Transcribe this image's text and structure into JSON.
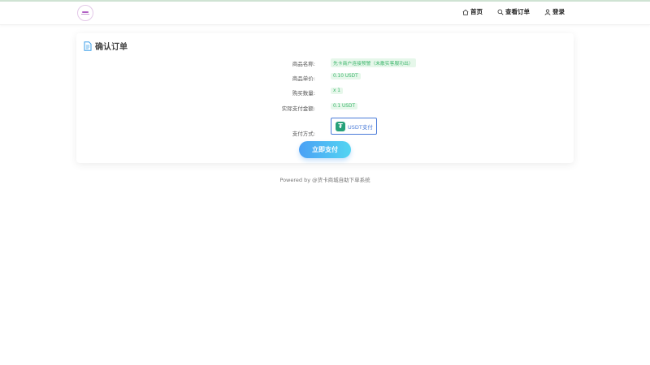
{
  "nav": {
    "home": "首页",
    "orders": "查看订单",
    "login": "登录"
  },
  "card": {
    "title": "确认订单"
  },
  "order": {
    "rows": [
      {
        "label": "商品名称:",
        "value": "先卡商户连接预警（未散实客服功出）"
      },
      {
        "label": "商品单价:",
        "value": "0.10 USDT"
      },
      {
        "label": "购买数量:",
        "value": "x 1"
      },
      {
        "label": "实际支付金额:",
        "value": "0.1 USDT"
      }
    ],
    "payment_label": "支付方式:",
    "payment_method": "USDT支付"
  },
  "pay_button": "立即支付",
  "footer": "Powered by @货卡商城自助下单系统",
  "colors": {
    "accent": "#4aa0f5",
    "value_bg": "#e6f7ea",
    "value_text": "#3bb56b",
    "tether": "#27a17a"
  },
  "icons": {
    "home": "home-icon",
    "search": "search-icon",
    "user": "user-icon",
    "document": "document-icon",
    "tether": "tether-icon"
  }
}
